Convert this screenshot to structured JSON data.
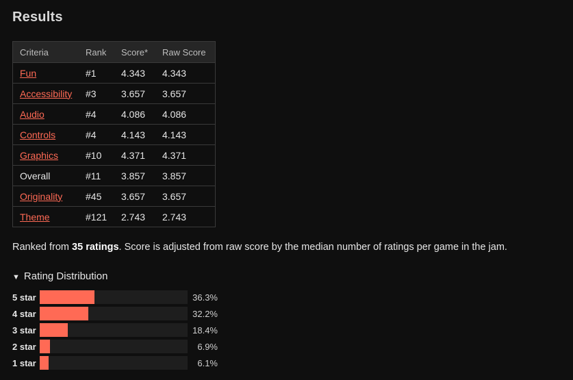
{
  "title": "Results",
  "table": {
    "headers": [
      "Criteria",
      "Rank",
      "Score*",
      "Raw Score"
    ],
    "rows": [
      {
        "criteria": "Fun",
        "rank": "#1",
        "score": "4.343",
        "raw": "4.343",
        "link": true
      },
      {
        "criteria": "Accessibility",
        "rank": "#3",
        "score": "3.657",
        "raw": "3.657",
        "link": true
      },
      {
        "criteria": "Audio",
        "rank": "#4",
        "score": "4.086",
        "raw": "4.086",
        "link": true
      },
      {
        "criteria": "Controls",
        "rank": "#4",
        "score": "4.143",
        "raw": "4.143",
        "link": true
      },
      {
        "criteria": "Graphics",
        "rank": "#10",
        "score": "4.371",
        "raw": "4.371",
        "link": true
      },
      {
        "criteria": "Overall",
        "rank": "#11",
        "score": "3.857",
        "raw": "3.857",
        "link": false
      },
      {
        "criteria": "Originality",
        "rank": "#45",
        "score": "3.657",
        "raw": "3.657",
        "link": true
      },
      {
        "criteria": "Theme",
        "rank": "#121",
        "score": "2.743",
        "raw": "2.743",
        "link": true
      }
    ]
  },
  "summary": {
    "prefix": "Ranked from ",
    "count": "35 ratings",
    "suffix": ". Score is adjusted from raw score by the median number of ratings per game in the jam."
  },
  "distribution": {
    "toggle_icon": "▼",
    "toggle_label": "Rating Distribution",
    "max_pct": 36.3,
    "rows": [
      {
        "label": "5 star",
        "pct": 36.3,
        "pct_text": "36.3%"
      },
      {
        "label": "4 star",
        "pct": 32.2,
        "pct_text": "32.2%"
      },
      {
        "label": "3 star",
        "pct": 18.4,
        "pct_text": "18.4%"
      },
      {
        "label": "2 star",
        "pct": 6.9,
        "pct_text": "6.9%"
      },
      {
        "label": "1 star",
        "pct": 6.1,
        "pct_text": "6.1%"
      }
    ]
  },
  "colors": {
    "accent": "#ff6a55",
    "background": "#0f0f0f",
    "table_header": "#262626"
  }
}
